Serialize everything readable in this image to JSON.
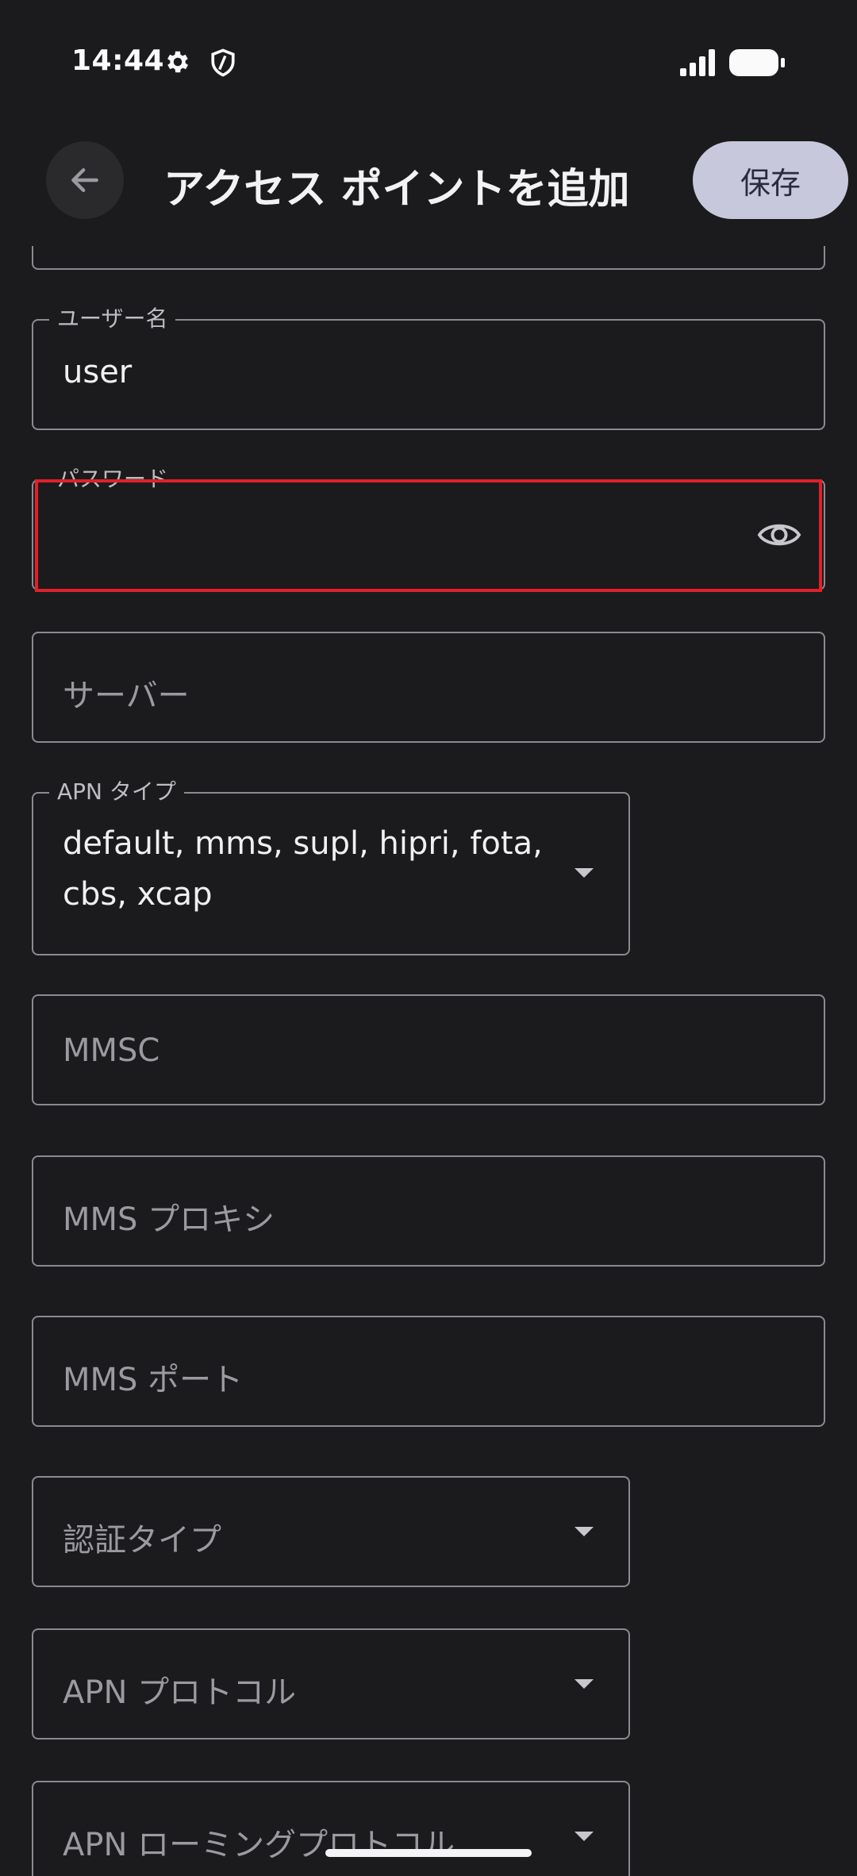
{
  "status_bar": {
    "time": "14:44",
    "icons": [
      "gear-icon",
      "shield-icon",
      "signal-icon",
      "battery-icon"
    ]
  },
  "app_bar": {
    "back_icon": "arrow-left-icon",
    "title": "アクセス ポイントを追加",
    "save_label": "保存"
  },
  "fields": {
    "username": {
      "label": "ユーザー名",
      "value": "user"
    },
    "password": {
      "label": "パスワード",
      "value": "",
      "icon": "eye-icon"
    },
    "server": {
      "placeholder": "サーバー"
    },
    "apn_type": {
      "label": "APN タイプ",
      "value_line1": "default, mms, supl, hipri, fota,",
      "value_line2": "cbs, xcap"
    },
    "mmsc": {
      "placeholder": "MMSC"
    },
    "mms_proxy": {
      "placeholder": "MMS プロキシ"
    },
    "mms_port": {
      "placeholder": "MMS ポート"
    },
    "auth_type": {
      "placeholder": "認証タイプ"
    },
    "apn_protocol": {
      "placeholder": "APN プロトコル"
    },
    "apn_roaming_protocol": {
      "placeholder": "APN ローミングプロトコル"
    }
  },
  "colors": {
    "background": "#1b1b1d",
    "save_button": "#c7c8dc",
    "field_border": "#8a8a90",
    "highlight": "#e0202a"
  }
}
